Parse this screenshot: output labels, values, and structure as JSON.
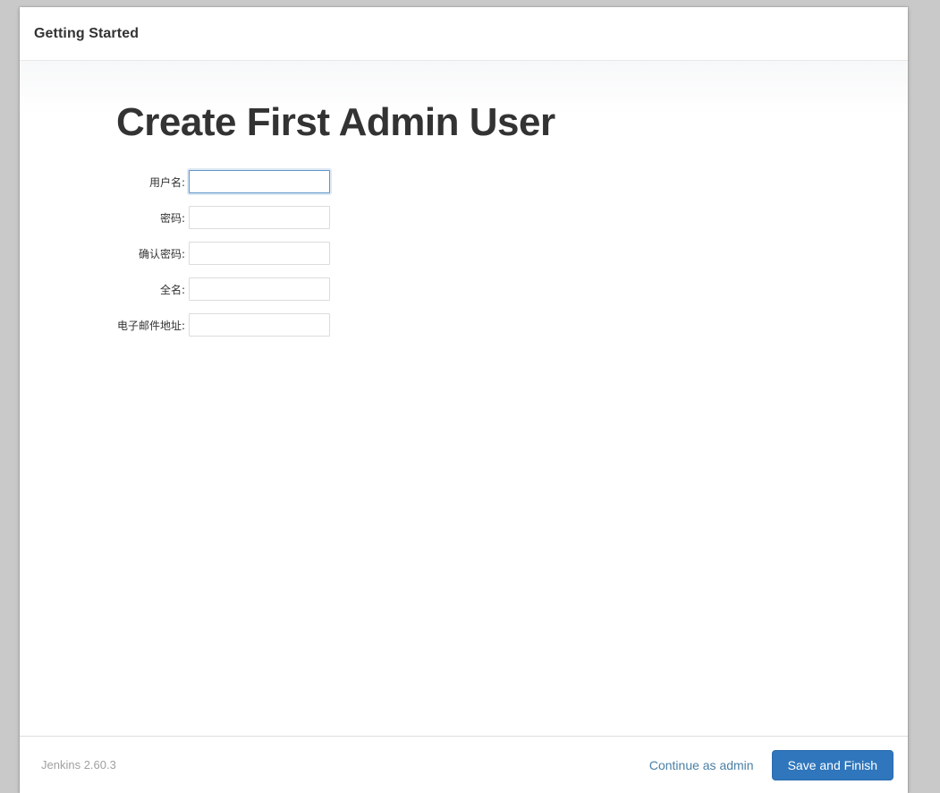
{
  "window": {
    "background_color": "#c9c9c9"
  },
  "header": {
    "title": "Getting Started"
  },
  "main": {
    "page_title": "Create First Admin User",
    "form": {
      "fields": [
        {
          "label": "用户名:",
          "value": "",
          "type": "text",
          "name": "username",
          "focused": true
        },
        {
          "label": "密码:",
          "value": "",
          "type": "password",
          "name": "password",
          "focused": false
        },
        {
          "label": "确认密码:",
          "value": "",
          "type": "password",
          "name": "confirm-password",
          "focused": false
        },
        {
          "label": "全名:",
          "value": "",
          "type": "text",
          "name": "fullname",
          "focused": false
        },
        {
          "label": "电子邮件地址:",
          "value": "",
          "type": "text",
          "name": "email",
          "focused": false
        }
      ]
    }
  },
  "footer": {
    "version": "Jenkins 2.60.3",
    "continue_link": "Continue as admin",
    "save_button": "Save and Finish",
    "accent_color": "#2f76bc",
    "link_color": "#4a7fa5"
  }
}
